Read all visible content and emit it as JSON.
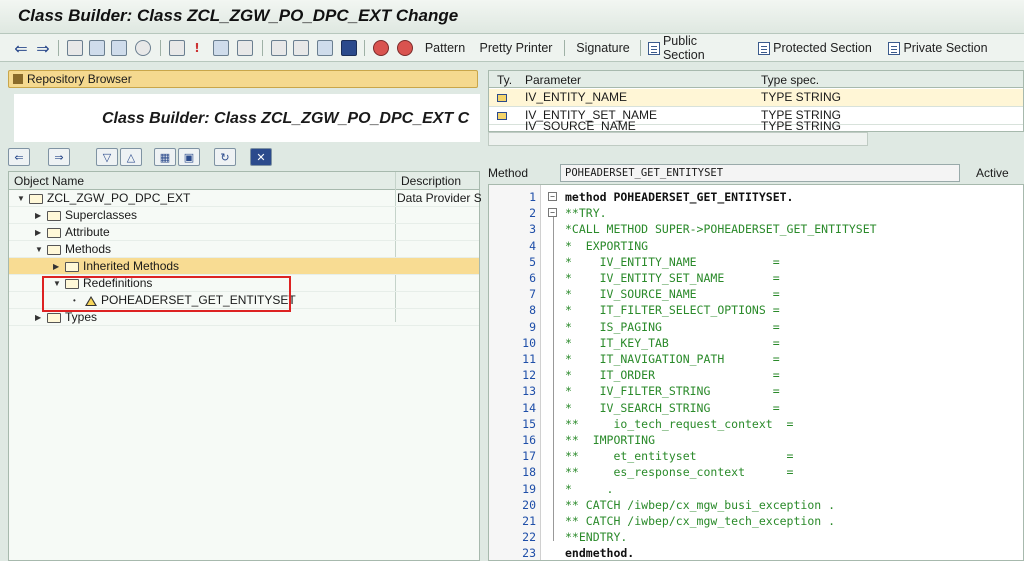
{
  "window": {
    "title": "Class Builder: Class ZCL_ZGW_PO_DPC_EXT Change"
  },
  "toolbar": {
    "pattern": "Pattern",
    "pretty_printer": "Pretty Printer",
    "signature": "Signature",
    "public_section": "Public Section",
    "protected_section": "Protected Section",
    "private_section": "Private Section"
  },
  "repository": {
    "label": "Repository Browser",
    "overlay_title": "Class Builder: Class ZCL_ZGW_PO_DPC_EXT C"
  },
  "tree": {
    "col_object": "Object Name",
    "col_desc": "Description",
    "root": {
      "label": "ZCL_ZGW_PO_DPC_EXT",
      "desc": "Data Provider S"
    },
    "superclasses": "Superclasses",
    "attribute": "Attribute",
    "methods": "Methods",
    "inherited": "Inherited Methods",
    "redefinitions": "Redefinitions",
    "method_item": "POHEADERSET_GET_ENTITYSET",
    "types": "Types"
  },
  "params": {
    "col_ty": "Ty.",
    "col_param": "Parameter",
    "col_type": "Type spec.",
    "rows": [
      {
        "name": "IV_ENTITY_NAME",
        "type": "TYPE STRING"
      },
      {
        "name": "IV_ENTITY_SET_NAME",
        "type": "TYPE STRING"
      },
      {
        "name": "IV_SOURCE_NAME",
        "type": "TYPE STRING"
      }
    ]
  },
  "method": {
    "label": "Method",
    "name": "POHEADERSET_GET_ENTITYSET",
    "status": "Active"
  },
  "code_lines": [
    {
      "n": "1",
      "t": "method POHEADERSET_GET_ENTITYSET.",
      "k": "k",
      "f": "⊟"
    },
    {
      "n": "2",
      "t": "**TRY.",
      "k": "c",
      "f": "⊟"
    },
    {
      "n": "3",
      "t": "*CALL METHOD SUPER->POHEADERSET_GET_ENTITYSET",
      "k": "c",
      "f": ""
    },
    {
      "n": "4",
      "t": "*  EXPORTING",
      "k": "c",
      "f": ""
    },
    {
      "n": "5",
      "t": "*    IV_ENTITY_NAME           =",
      "k": "c",
      "f": ""
    },
    {
      "n": "6",
      "t": "*    IV_ENTITY_SET_NAME       =",
      "k": "c",
      "f": ""
    },
    {
      "n": "7",
      "t": "*    IV_SOURCE_NAME           =",
      "k": "c",
      "f": ""
    },
    {
      "n": "8",
      "t": "*    IT_FILTER_SELECT_OPTIONS =",
      "k": "c",
      "f": ""
    },
    {
      "n": "9",
      "t": "*    IS_PAGING                =",
      "k": "c",
      "f": ""
    },
    {
      "n": "10",
      "t": "*    IT_KEY_TAB               =",
      "k": "c",
      "f": ""
    },
    {
      "n": "11",
      "t": "*    IT_NAVIGATION_PATH       =",
      "k": "c",
      "f": ""
    },
    {
      "n": "12",
      "t": "*    IT_ORDER                 =",
      "k": "c",
      "f": ""
    },
    {
      "n": "13",
      "t": "*    IV_FILTER_STRING         =",
      "k": "c",
      "f": ""
    },
    {
      "n": "14",
      "t": "*    IV_SEARCH_STRING         =",
      "k": "c",
      "f": ""
    },
    {
      "n": "15",
      "t": "**     io_tech_request_context  =",
      "k": "c",
      "f": ""
    },
    {
      "n": "16",
      "t": "**  IMPORTING",
      "k": "c",
      "f": ""
    },
    {
      "n": "17",
      "t": "**     et_entityset             =",
      "k": "c",
      "f": ""
    },
    {
      "n": "18",
      "t": "**     es_response_context      =",
      "k": "c",
      "f": ""
    },
    {
      "n": "19",
      "t": "*     .",
      "k": "c",
      "f": ""
    },
    {
      "n": "20",
      "t": "** CATCH /iwbep/cx_mgw_busi_exception .",
      "k": "c",
      "f": ""
    },
    {
      "n": "21",
      "t": "** CATCH /iwbep/cx_mgw_tech_exception .",
      "k": "c",
      "f": ""
    },
    {
      "n": "22",
      "t": "**ENDTRY.",
      "k": "c",
      "f": ""
    },
    {
      "n": "23",
      "t": "endmethod.",
      "k": "k",
      "f": ""
    }
  ]
}
